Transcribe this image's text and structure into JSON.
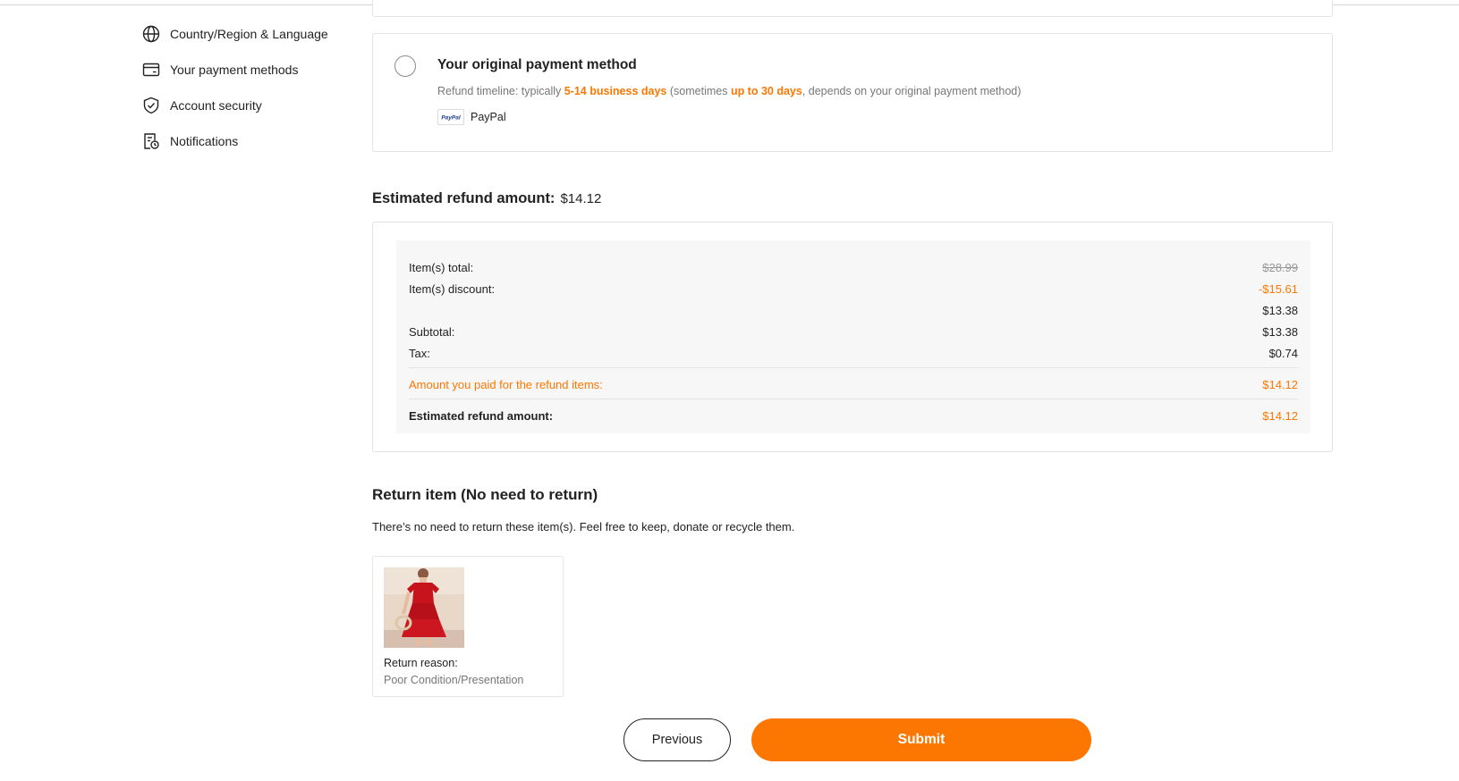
{
  "sidebar": {
    "items": [
      {
        "label": "Country/Region & Language",
        "icon": "globe-icon"
      },
      {
        "label": "Your payment methods",
        "icon": "credit-card-icon"
      },
      {
        "label": "Account security",
        "icon": "shield-check-icon"
      },
      {
        "label": "Notifications",
        "icon": "notification-doc-icon"
      }
    ]
  },
  "payment_option": {
    "title": "Your original payment method",
    "timeline_prefix": "Refund timeline: typically ",
    "timeline_hl1": "5-14 business days",
    "timeline_mid": " (sometimes ",
    "timeline_hl2": "up to 30 days",
    "timeline_suffix": ", depends on your original payment method)",
    "method_name": "PayPal",
    "method_logo_text": "PayPal",
    "selected": false
  },
  "estimate": {
    "heading": "Estimated refund amount:",
    "amount": "$14.12"
  },
  "summary": {
    "rows": [
      {
        "label": "Item(s) total:",
        "value": "$28.99"
      },
      {
        "label": "Item(s) discount:",
        "value": "-$15.61"
      },
      {
        "label": "",
        "value": "$13.38"
      },
      {
        "label": "Subtotal:",
        "value": "$13.38"
      },
      {
        "label": "Tax:",
        "value": "$0.74"
      },
      {
        "label": "Amount you paid for the refund items:",
        "value": "$14.12"
      },
      {
        "label": "Estimated refund amount:",
        "value": "$14.12"
      }
    ]
  },
  "return_section": {
    "heading": "Return item (No need to return)",
    "description": "There’s no need to return these item(s). Feel free to keep, donate or recycle them.",
    "item": {
      "reason_label": "Return reason:",
      "reason_value": "Poor Condition/Presentation"
    }
  },
  "actions": {
    "previous_label": "Previous",
    "submit_label": "Submit"
  },
  "colors": {
    "accent": "#fb7701",
    "border": "#e3e3e3",
    "panel_bg": "#f7f7f7"
  }
}
